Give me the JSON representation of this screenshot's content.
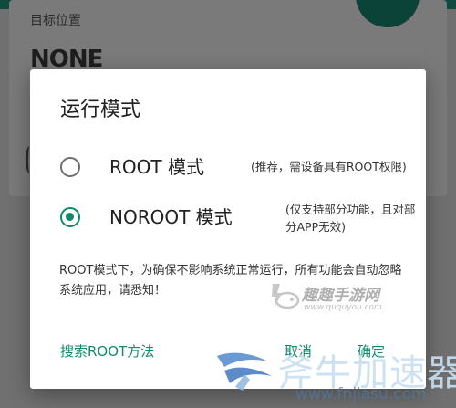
{
  "background": {
    "section_label": "目标位置",
    "section_value": "NONE"
  },
  "dialog": {
    "title": "运行模式",
    "options": [
      {
        "label": "ROOT 模式",
        "hint": "(推荐，需设备具有ROOT权限)",
        "selected": false
      },
      {
        "label": "NOROOT 模式",
        "hint": "(仅支持部分功能，且对部分APP无效)",
        "selected": true
      }
    ],
    "message": "ROOT模式下，为确保不影响系统正常运行，所有功能会自动忽略系统应用，请悉知！",
    "buttons": {
      "search_root": "搜索ROOT方法",
      "cancel": "取消",
      "ok": "确定"
    }
  },
  "watermarks": {
    "quqi_name": "趣趣手游网",
    "quqi_url": "www.ququyou.com",
    "fn_name": "斧牛加速器",
    "fn_url": "www.fnjiasu.com"
  },
  "colors": {
    "accent": "#0f8a6e",
    "scrim": "#707070",
    "dialog_bg": "#ffffff"
  }
}
